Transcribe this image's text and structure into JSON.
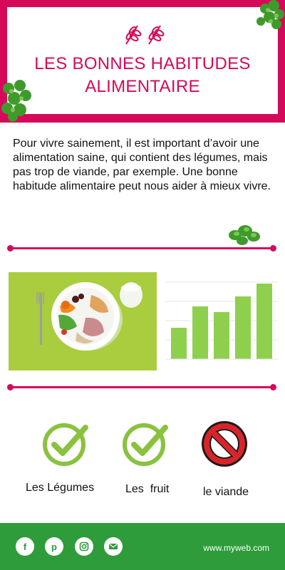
{
  "header": {
    "title_line1": "LES BONNES HABITUDES",
    "title_line2": "ALIMENTAIRE",
    "accent_color": "#d5095a"
  },
  "intro": {
    "text": "Pour vivre sainement, il est important d’avoir une alimentation saine, qui contient des légumes, mais pas trop de viande, par exemple. Une bonne habitude alimentaire peut nous aider à mieux vivre."
  },
  "chart_data": {
    "type": "bar",
    "values": [
      22,
      37,
      33,
      44,
      53
    ],
    "bar_color": "#8fcf4e"
  },
  "items": [
    {
      "label": "Les Légumes",
      "icon": "green-check-icon"
    },
    {
      "label": "Les  fruit",
      "icon": "green-check-icon"
    },
    {
      "label": "le viande",
      "icon": "red-prohibited-icon"
    }
  ],
  "footer": {
    "background": "#2e9c3a",
    "website": "www.myweb.com",
    "social_icons": [
      "facebook-icon",
      "pinterest-icon",
      "instagram-icon",
      "email-icon"
    ]
  }
}
